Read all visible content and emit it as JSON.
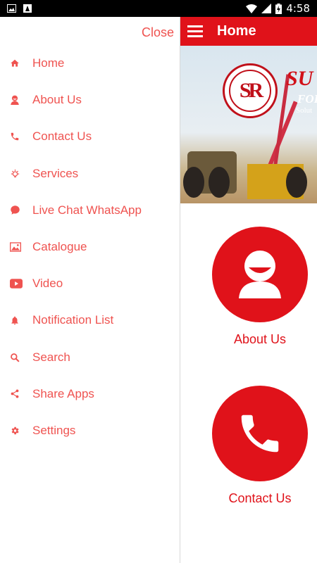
{
  "status_bar": {
    "time": "4:58",
    "icons": [
      "image-icon",
      "app-icon",
      "wifi-icon",
      "signal-icon",
      "battery-charging-icon"
    ]
  },
  "drawer": {
    "close_label": "Close",
    "items": [
      {
        "label": "Home",
        "icon": "home-icon"
      },
      {
        "label": "About Us",
        "icon": "person-icon"
      },
      {
        "label": "Contact Us",
        "icon": "phone-icon"
      },
      {
        "label": "Services",
        "icon": "lightbulb-icon"
      },
      {
        "label": "Live Chat WhatsApp",
        "icon": "chat-icon"
      },
      {
        "label": "Catalogue",
        "icon": "image-icon"
      },
      {
        "label": "Video",
        "icon": "youtube-icon"
      },
      {
        "label": "Notification List",
        "icon": "bell-icon"
      },
      {
        "label": "Search",
        "icon": "search-icon"
      },
      {
        "label": "Share Apps",
        "icon": "share-icon"
      },
      {
        "label": "Settings",
        "icon": "gear-icon"
      }
    ]
  },
  "app_bar": {
    "title": "Home"
  },
  "banner": {
    "logo_letters": "SR",
    "brand_text": "SU",
    "sub_text": "FORK",
    "sub_text2": "Solut"
  },
  "tiles": [
    {
      "label": "About Us",
      "icon": "person-icon"
    },
    {
      "label": "Contact Us",
      "icon": "phone-icon"
    }
  ],
  "colors": {
    "primary": "#e0121a",
    "drawer_text": "#ef5350"
  }
}
